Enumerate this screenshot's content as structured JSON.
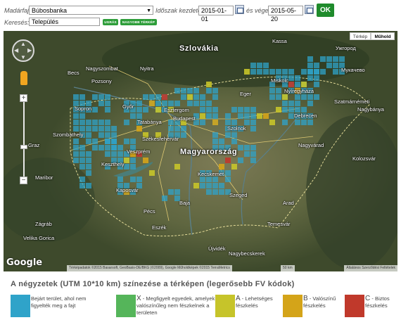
{
  "filters": {
    "species_label": "Madárfaj:",
    "species_value": "Búbosbanka",
    "period_label": "Időszak kezdete:",
    "start_date": "2015-01-01",
    "end_label": "és vége:",
    "end_date": "2015-05-20",
    "ok_label": "OK",
    "search_label": "Keresés:",
    "search_value": "Település",
    "go_button": "UGRÁS",
    "big_map_button": "NAGYOBB TÉRKÉP"
  },
  "map": {
    "types": [
      "Térkép",
      "Műhold"
    ],
    "active_type": "Műhold",
    "countries": [
      "Szlovákia",
      "Magyarország"
    ],
    "cities": [
      "Kassa",
      "Ужгород",
      "Miskolc",
      "Nyíregyháza",
      "Мукачево",
      "Eger",
      "Szatmárnémeti",
      "Nagybánya",
      "Debrecen",
      "Budapest",
      "Szolnok",
      "Nagyvárad",
      "Becs",
      "Pozsony",
      "Nagyszombat",
      "Nyitra",
      "Sopron",
      "Győr",
      "Esztergom",
      "Tatabánya",
      "Szombathely",
      "Székesfehérvár",
      "Veszprém",
      "Keszthely",
      "Kecskemét",
      "Kolozsvár",
      "Graz",
      "Maribor",
      "Kaposvár",
      "Szeged",
      "Arad",
      "Pécs",
      "Baja",
      "Zágráb",
      "Eszék",
      "Temesvár",
      "Újvidék",
      "Nagybecskerek",
      "Velika Gorica"
    ],
    "google_logo": "Google",
    "attribution": "Térképadatok ©2015 Basarsoft, GeoBasis-DE/BKG (©2009), Google Műholdképek ©2015 TerraMetrics",
    "scale": "50 km",
    "terms": "Általános Szerződési Feltételek",
    "controls": {
      "zoom_in": "+",
      "zoom_out": "−"
    }
  },
  "legend": {
    "title": "A négyzetek (UTM 10*10 km) színezése a térképen (legerősebb FV kódok)",
    "items": [
      {
        "code": "",
        "text": "Bejárt terület, ahol nem figyelték meg a fajt",
        "color": "#2fa3c9"
      },
      {
        "code": "X",
        "text": "- Megfigyelt egyedek, amelyek valószínűleg nem fészkelnek a területen",
        "color": "#55b55a"
      },
      {
        "code": "A",
        "text": "- Lehetséges fészkelés",
        "color": "#c6c42a"
      },
      {
        "code": "B",
        "text": "- Valószínű fészkelés",
        "color": "#d4a419"
      },
      {
        "code": "C",
        "text": "- Biztos fészkelés",
        "color": "#c0392b"
      }
    ]
  },
  "colors": {
    "surveyed": "#2fa3c9",
    "possible": "#c6c42a",
    "probable": "#d4a419",
    "confirmed": "#c0392b",
    "ok_button": "#1f8b2c"
  }
}
